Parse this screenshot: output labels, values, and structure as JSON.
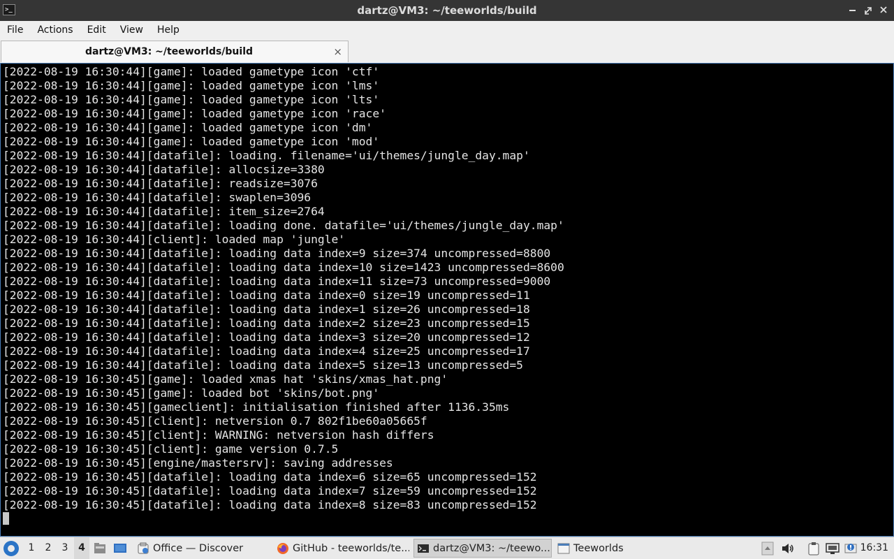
{
  "window": {
    "title": "dartz@VM3: ~/teeworlds/build",
    "controls": [
      "minimize",
      "maximize",
      "close"
    ]
  },
  "menu": {
    "items": [
      "File",
      "Actions",
      "Edit",
      "View",
      "Help"
    ]
  },
  "tab": {
    "label": "dartz@VM3: ~/teeworlds/build",
    "close": "×"
  },
  "terminal": {
    "lines": [
      "[2022-08-19 16:30:44][game]: loaded gametype icon 'ctf'",
      "[2022-08-19 16:30:44][game]: loaded gametype icon 'lms'",
      "[2022-08-19 16:30:44][game]: loaded gametype icon 'lts'",
      "[2022-08-19 16:30:44][game]: loaded gametype icon 'race'",
      "[2022-08-19 16:30:44][game]: loaded gametype icon 'dm'",
      "[2022-08-19 16:30:44][game]: loaded gametype icon 'mod'",
      "[2022-08-19 16:30:44][datafile]: loading. filename='ui/themes/jungle_day.map'",
      "[2022-08-19 16:30:44][datafile]: allocsize=3380",
      "[2022-08-19 16:30:44][datafile]: readsize=3076",
      "[2022-08-19 16:30:44][datafile]: swaplen=3096",
      "[2022-08-19 16:30:44][datafile]: item_size=2764",
      "[2022-08-19 16:30:44][datafile]: loading done. datafile='ui/themes/jungle_day.map'",
      "[2022-08-19 16:30:44][client]: loaded map 'jungle'",
      "[2022-08-19 16:30:44][datafile]: loading data index=9 size=374 uncompressed=8800",
      "[2022-08-19 16:30:44][datafile]: loading data index=10 size=1423 uncompressed=8600",
      "[2022-08-19 16:30:44][datafile]: loading data index=11 size=73 uncompressed=9000",
      "[2022-08-19 16:30:44][datafile]: loading data index=0 size=19 uncompressed=11",
      "[2022-08-19 16:30:44][datafile]: loading data index=1 size=26 uncompressed=18",
      "[2022-08-19 16:30:44][datafile]: loading data index=2 size=23 uncompressed=15",
      "[2022-08-19 16:30:44][datafile]: loading data index=3 size=20 uncompressed=12",
      "[2022-08-19 16:30:44][datafile]: loading data index=4 size=25 uncompressed=17",
      "[2022-08-19 16:30:44][datafile]: loading data index=5 size=13 uncompressed=5",
      "[2022-08-19 16:30:45][game]: loaded xmas hat 'skins/xmas_hat.png'",
      "[2022-08-19 16:30:45][game]: loaded bot 'skins/bot.png'",
      "[2022-08-19 16:30:45][gameclient]: initialisation finished after 1136.35ms",
      "[2022-08-19 16:30:45][client]: netversion 0.7 802f1be60a05665f",
      "[2022-08-19 16:30:45][client]: WARNING: netversion hash differs",
      "[2022-08-19 16:30:45][client]: game version 0.7.5",
      "[2022-08-19 16:30:45][engine/mastersrv]: saving addresses",
      "[2022-08-19 16:30:45][datafile]: loading data index=6 size=65 uncompressed=152",
      "[2022-08-19 16:30:45][datafile]: loading data index=7 size=59 uncompressed=152",
      "[2022-08-19 16:30:45][datafile]: loading data index=8 size=83 uncompressed=152"
    ]
  },
  "taskbar": {
    "desktops": [
      "1",
      "2",
      "3",
      "4"
    ],
    "active_desktop": "4",
    "tasks": [
      {
        "label": "Office — Discover",
        "icon": "discover-icon"
      },
      {
        "label": "GitHub - teeworlds/te...",
        "icon": "firefox-icon"
      },
      {
        "label": "dartz@VM3: ~/teewo...",
        "icon": "terminal-icon"
      },
      {
        "label": "Teeworlds",
        "icon": "window-icon"
      }
    ],
    "clock": "16:31"
  },
  "colors": {
    "terminal_bg": "#000000",
    "terminal_fg": "#e4e4e4",
    "titlebar_bg": "#353535",
    "accent": "#4a7db8"
  }
}
